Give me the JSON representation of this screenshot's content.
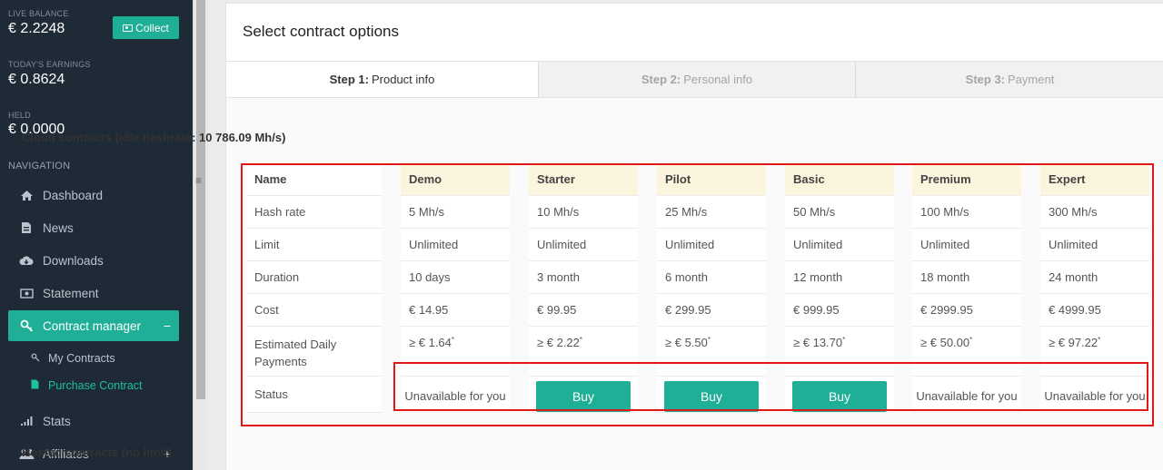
{
  "sidebar": {
    "live_balance_label": "LIVE BALANCE",
    "live_balance_value": "€ 2.2248",
    "collect_label": "Collect",
    "todays_earnings_label": "TODAY'S EARNINGS",
    "todays_earnings_value": "€ 0.8624",
    "held_label": "HELD",
    "held_value": "€ 0.0000",
    "navigation_heading": "NAVIGATION",
    "items": [
      {
        "label": "Dashboard",
        "icon": "home-icon"
      },
      {
        "label": "News",
        "icon": "document-icon"
      },
      {
        "label": "Downloads",
        "icon": "cloud-download-icon"
      },
      {
        "label": "Statement",
        "icon": "money-icon"
      },
      {
        "label": "Contract manager",
        "icon": "key-icon",
        "trail": "−"
      },
      {
        "label": "Stats",
        "icon": "signal-icon"
      },
      {
        "label": "Affiliates",
        "icon": "users-icon",
        "trail": "+"
      }
    ],
    "sub_items": [
      {
        "label": "My Contracts",
        "icon": "key-icon"
      },
      {
        "label": "Purchase Contract",
        "icon": "file-icon"
      }
    ]
  },
  "main": {
    "title": "Select contract options",
    "steps": [
      {
        "prefix": "Step 1:",
        "label": "Product info"
      },
      {
        "prefix": "Step 2:",
        "label": "Personal info"
      },
      {
        "prefix": "Step 3:",
        "label": "Payment"
      }
    ],
    "cloud_title": "Cloud contracts (idle hashrate: 10 786.09 Mh/s)",
    "hosted_title": "Hosted contracts (no limit)",
    "row_labels": [
      "Name",
      "Hash rate",
      "Limit",
      "Duration",
      "Cost",
      "Estimated Daily Payments",
      "Status"
    ],
    "plans": [
      {
        "name": "Demo",
        "hash_rate": "5 Mh/s",
        "limit": "Unlimited",
        "duration": "10 days",
        "cost": "€ 14.95",
        "daily": "≥ € 1.64",
        "status": "Unavailable for you"
      },
      {
        "name": "Starter",
        "hash_rate": "10 Mh/s",
        "limit": "Unlimited",
        "duration": "3 month",
        "cost": "€ 99.95",
        "daily": "≥ € 2.22",
        "status": "Buy"
      },
      {
        "name": "Pilot",
        "hash_rate": "25 Mh/s",
        "limit": "Unlimited",
        "duration": "6 month",
        "cost": "€ 299.95",
        "daily": "≥ € 5.50",
        "status": "Buy"
      },
      {
        "name": "Basic",
        "hash_rate": "50 Mh/s",
        "limit": "Unlimited",
        "duration": "12 month",
        "cost": "€ 999.95",
        "daily": "≥ € 13.70",
        "status": "Buy"
      },
      {
        "name": "Premium",
        "hash_rate": "100 Mh/s",
        "limit": "Unlimited",
        "duration": "18 month",
        "cost": "€ 2999.95",
        "daily": "≥ € 50.00",
        "status": "Unavailable for you"
      },
      {
        "name": "Expert",
        "hash_rate": "300 Mh/s",
        "limit": "Unlimited",
        "duration": "24 month",
        "cost": "€ 4999.95",
        "daily": "≥ € 97.22",
        "status": "Unavailable for you"
      }
    ],
    "footnote_mark": "*"
  },
  "colors": {
    "sidebar_bg": "#1e2a36",
    "accent": "#1fae96",
    "highlight": "#e01818",
    "plan_header_bg": "#fcf5dd"
  }
}
